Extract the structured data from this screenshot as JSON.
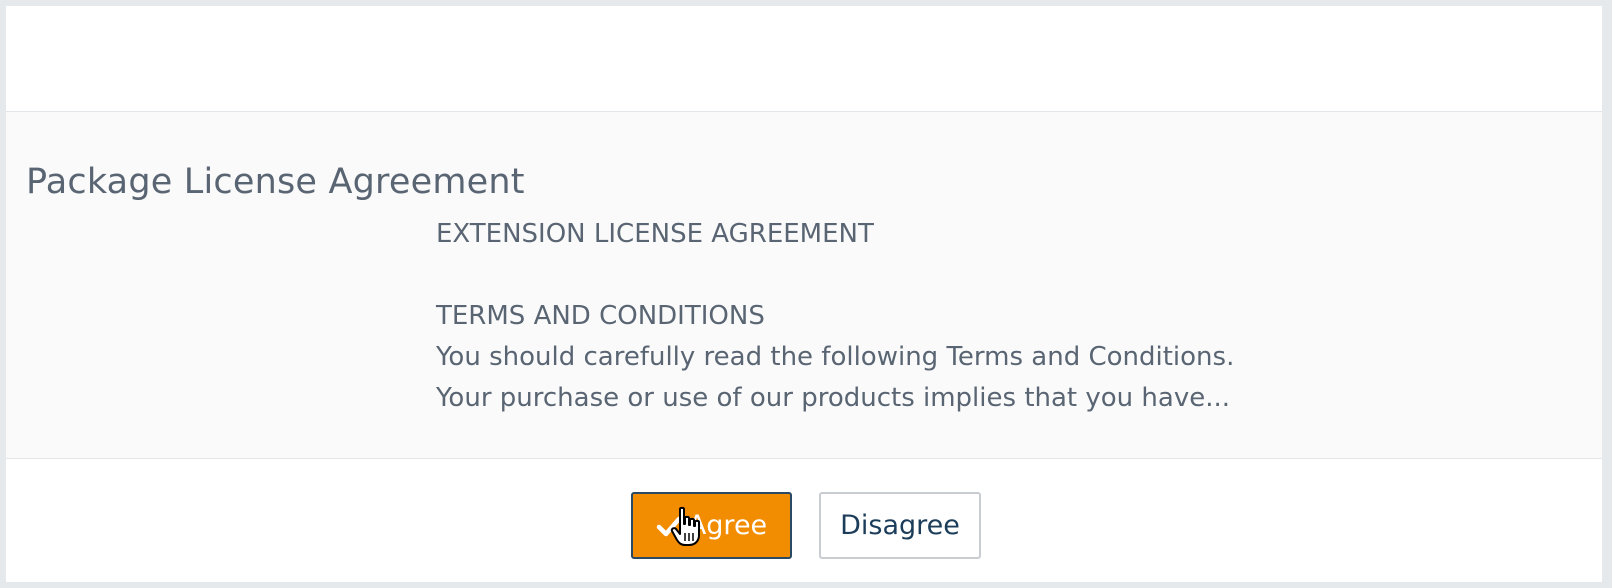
{
  "dialog": {
    "title": "Package License Agreement",
    "license_lines": [
      "EXTENSION LICENSE AGREEMENT",
      "",
      "TERMS AND CONDITIONS",
      "You should carefully read the following Terms and Conditions.",
      "Your purchase or use of our products implies that you have..."
    ],
    "agree_label": "Agree",
    "disagree_label": "Disagree"
  },
  "icons": {
    "agree_icon": "checkmark-icon",
    "cursor": "hand-pointer-cursor-icon"
  },
  "colors": {
    "agree_background": "#f28c00",
    "agree_border": "#2a4a63",
    "disagree_text": "#1c3d5a",
    "body_text": "#5a6573"
  }
}
